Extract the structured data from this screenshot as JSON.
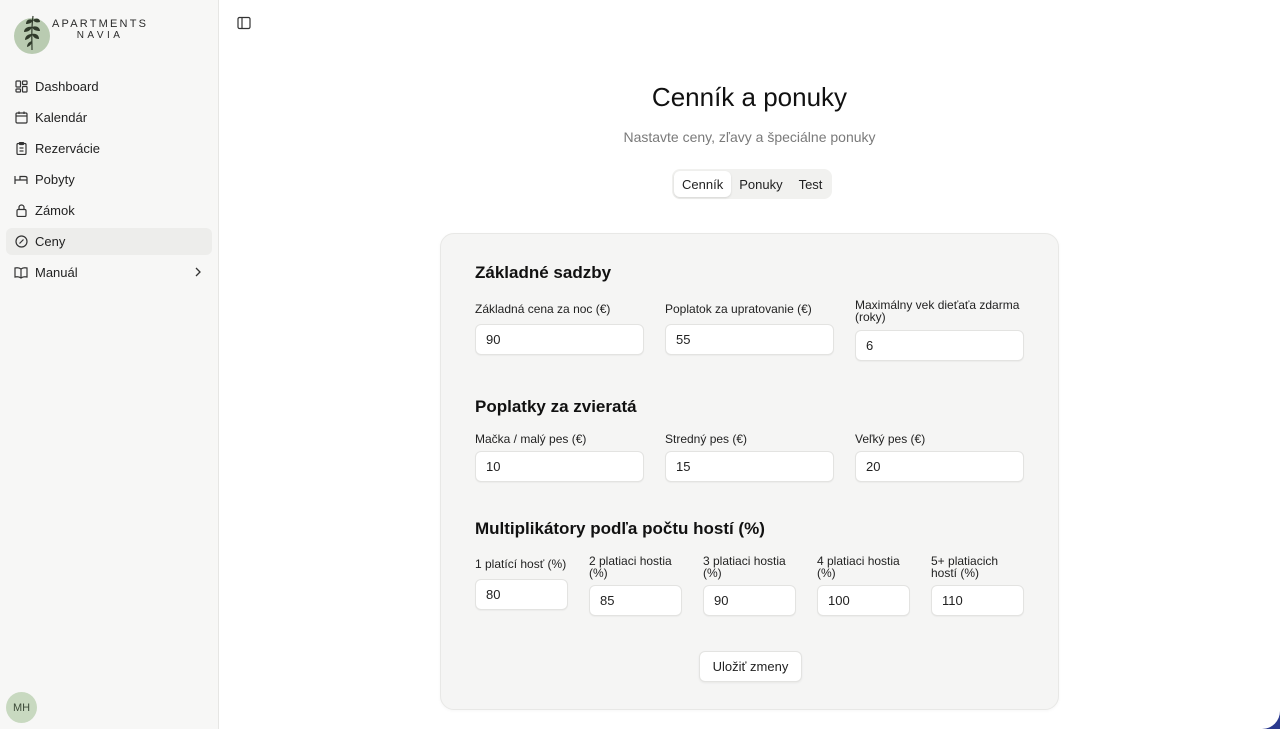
{
  "brand": {
    "line1": "APARTMENTS",
    "line2": "NAVIA"
  },
  "sidebar": {
    "items": [
      {
        "label": "Dashboard",
        "icon": "dashboard-icon"
      },
      {
        "label": "Kalendár",
        "icon": "calendar-icon"
      },
      {
        "label": "Rezervácie",
        "icon": "clipboard-icon"
      },
      {
        "label": "Pobyty",
        "icon": "bed-icon"
      },
      {
        "label": "Zámok",
        "icon": "lock-icon"
      },
      {
        "label": "Ceny",
        "icon": "badge-percent-icon",
        "active": true
      },
      {
        "label": "Manuál",
        "icon": "book-icon",
        "has_chevron": true
      }
    ],
    "user_initials": "MH"
  },
  "page": {
    "title": "Cenník a ponuky",
    "subtitle": "Nastavte ceny, zľavy a špeciálne ponuky"
  },
  "tabs": [
    {
      "label": "Cenník",
      "active": true
    },
    {
      "label": "Ponuky",
      "active": false
    },
    {
      "label": "Test",
      "active": false
    }
  ],
  "sections": {
    "base": {
      "title": "Základné sadzby",
      "fields": [
        {
          "label": "Základná cena za noc (€)",
          "value": "90"
        },
        {
          "label": "Poplatok za upratovanie (€)",
          "value": "55"
        },
        {
          "label": "Maximálny vek dieťaťa zdarma (roky)",
          "value": "6"
        }
      ]
    },
    "pets": {
      "title": "Poplatky za zvieratá",
      "fields": [
        {
          "label": "Mačka / malý pes (€)",
          "value": "10"
        },
        {
          "label": "Stredný pes (€)",
          "value": "15"
        },
        {
          "label": "Veľký pes (€)",
          "value": "20"
        }
      ]
    },
    "multipliers": {
      "title": "Multiplikátory podľa počtu hostí (%)",
      "fields": [
        {
          "label": "1 platící hosť (%)",
          "value": "80"
        },
        {
          "label": "2 platiaci hostia (%)",
          "value": "85"
        },
        {
          "label": "3 platiaci hostia (%)",
          "value": "90"
        },
        {
          "label": "4 platiaci hostia (%)",
          "value": "100"
        },
        {
          "label": "5+ platiacich hostí (%)",
          "value": "110"
        }
      ]
    }
  },
  "actions": {
    "save_label": "Uložiť zmeny"
  },
  "colors": {
    "sidebar_bg": "#f7f7f6",
    "card_bg": "#f5f5f4",
    "logo_green": "#b9cbb1",
    "window_edge": "#2b3a8f"
  }
}
